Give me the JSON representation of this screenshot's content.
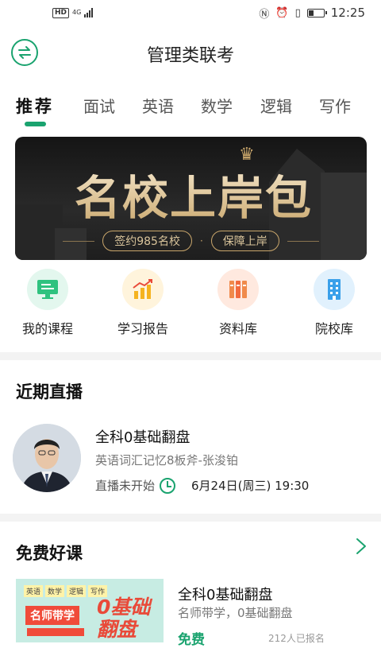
{
  "status_bar": {
    "hd": "HD",
    "network": "4G",
    "time": "12:25"
  },
  "header": {
    "title": "管理类联考"
  },
  "tabs": [
    {
      "label": "推荐",
      "active": true
    },
    {
      "label": "面试"
    },
    {
      "label": "英语"
    },
    {
      "label": "数学"
    },
    {
      "label": "逻辑"
    },
    {
      "label": "写作"
    }
  ],
  "banner": {
    "title": "名校上岸包",
    "tag1": "签约985名校",
    "separator": "·",
    "tag2": "保障上岸"
  },
  "quick_links": [
    {
      "label": "我的课程",
      "icon": "monitor-icon"
    },
    {
      "label": "学习报告",
      "icon": "report-chart-icon"
    },
    {
      "label": "资料库",
      "icon": "books-icon"
    },
    {
      "label": "院校库",
      "icon": "building-icon"
    }
  ],
  "live": {
    "section_title": "近期直播",
    "course_name": "全科0基础翻盘",
    "subtitle": "英语词汇记忆8板斧-张浚铂",
    "status": "直播未开始",
    "time": "6月24日(周三) 19:30"
  },
  "free_courses": {
    "section_title": "免费好课",
    "items": [
      {
        "name": "全科0基础翻盘",
        "subtitle": "名师带学，0基础翻盘",
        "price": "免费",
        "count": "212人已报名",
        "cover_tags": [
          "英语",
          "数学",
          "逻辑",
          "写作"
        ],
        "cover_teacher": "名师带学",
        "cover_big_1": "0基础",
        "cover_big_2": "翻盘"
      }
    ]
  },
  "colors": {
    "accent": "#1aa36f",
    "banner_gold": "#c9a66b"
  }
}
